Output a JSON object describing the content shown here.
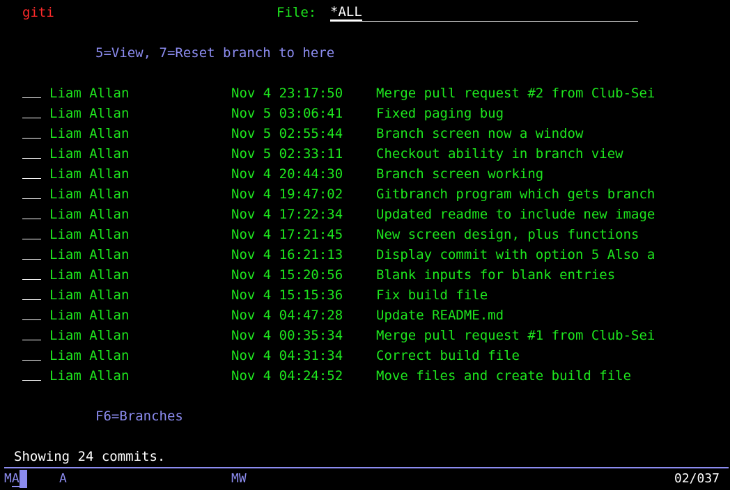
{
  "header": {
    "program": "giti",
    "file_label": "File:",
    "file_value": "*ALL"
  },
  "instructions": "5=View, 7=Reset branch to here",
  "commits": [
    {
      "author": "Liam Allan",
      "date": "Nov 4 23:17:50",
      "message": "Merge pull request #2 from Club-Sei"
    },
    {
      "author": "Liam Allan",
      "date": "Nov 5 03:06:41",
      "message": "Fixed paging bug"
    },
    {
      "author": "Liam Allan",
      "date": "Nov 5 02:55:44",
      "message": "Branch screen now a window"
    },
    {
      "author": "Liam Allan",
      "date": "Nov 5 02:33:11",
      "message": "Checkout ability in branch view"
    },
    {
      "author": "Liam Allan",
      "date": "Nov 4 20:44:30",
      "message": "Branch screen working"
    },
    {
      "author": "Liam Allan",
      "date": "Nov 4 19:47:02",
      "message": "Gitbranch program which gets branch"
    },
    {
      "author": "Liam Allan",
      "date": "Nov 4 17:22:34",
      "message": "Updated readme to include new image"
    },
    {
      "author": "Liam Allan",
      "date": "Nov 4 17:21:45",
      "message": "New screen design, plus functions"
    },
    {
      "author": "Liam Allan",
      "date": "Nov 4 16:21:13",
      "message": "Display commit with option 5 Also a"
    },
    {
      "author": "Liam Allan",
      "date": "Nov 4 15:20:56",
      "message": "Blank inputs for blank entries"
    },
    {
      "author": "Liam Allan",
      "date": "Nov 4 15:15:36",
      "message": "Fix build file"
    },
    {
      "author": "Liam Allan",
      "date": "Nov 4 04:47:28",
      "message": "Update README.md"
    },
    {
      "author": "Liam Allan",
      "date": "Nov 4 00:35:34",
      "message": "Merge pull request #1 from Club-Sei"
    },
    {
      "author": "Liam Allan",
      "date": "Nov 4 04:31:34",
      "message": "Correct build file"
    },
    {
      "author": "Liam Allan",
      "date": "Nov 4 04:24:52",
      "message": "Move files and create build file"
    }
  ],
  "function_keys": "F6=Branches",
  "message_line": "Showing 24 commits.",
  "status_bar": {
    "mode_prefix": "M",
    "mode_cursor": "A",
    "indicator_a": "A",
    "indicator_mw": "MW",
    "cursor_position": "02/037"
  },
  "colors": {
    "background": "#000000",
    "program_name": "#ff2a2a",
    "data_text": "#1ee61e",
    "instruction_text": "#8c8cf0",
    "input_text": "#ffffff"
  }
}
